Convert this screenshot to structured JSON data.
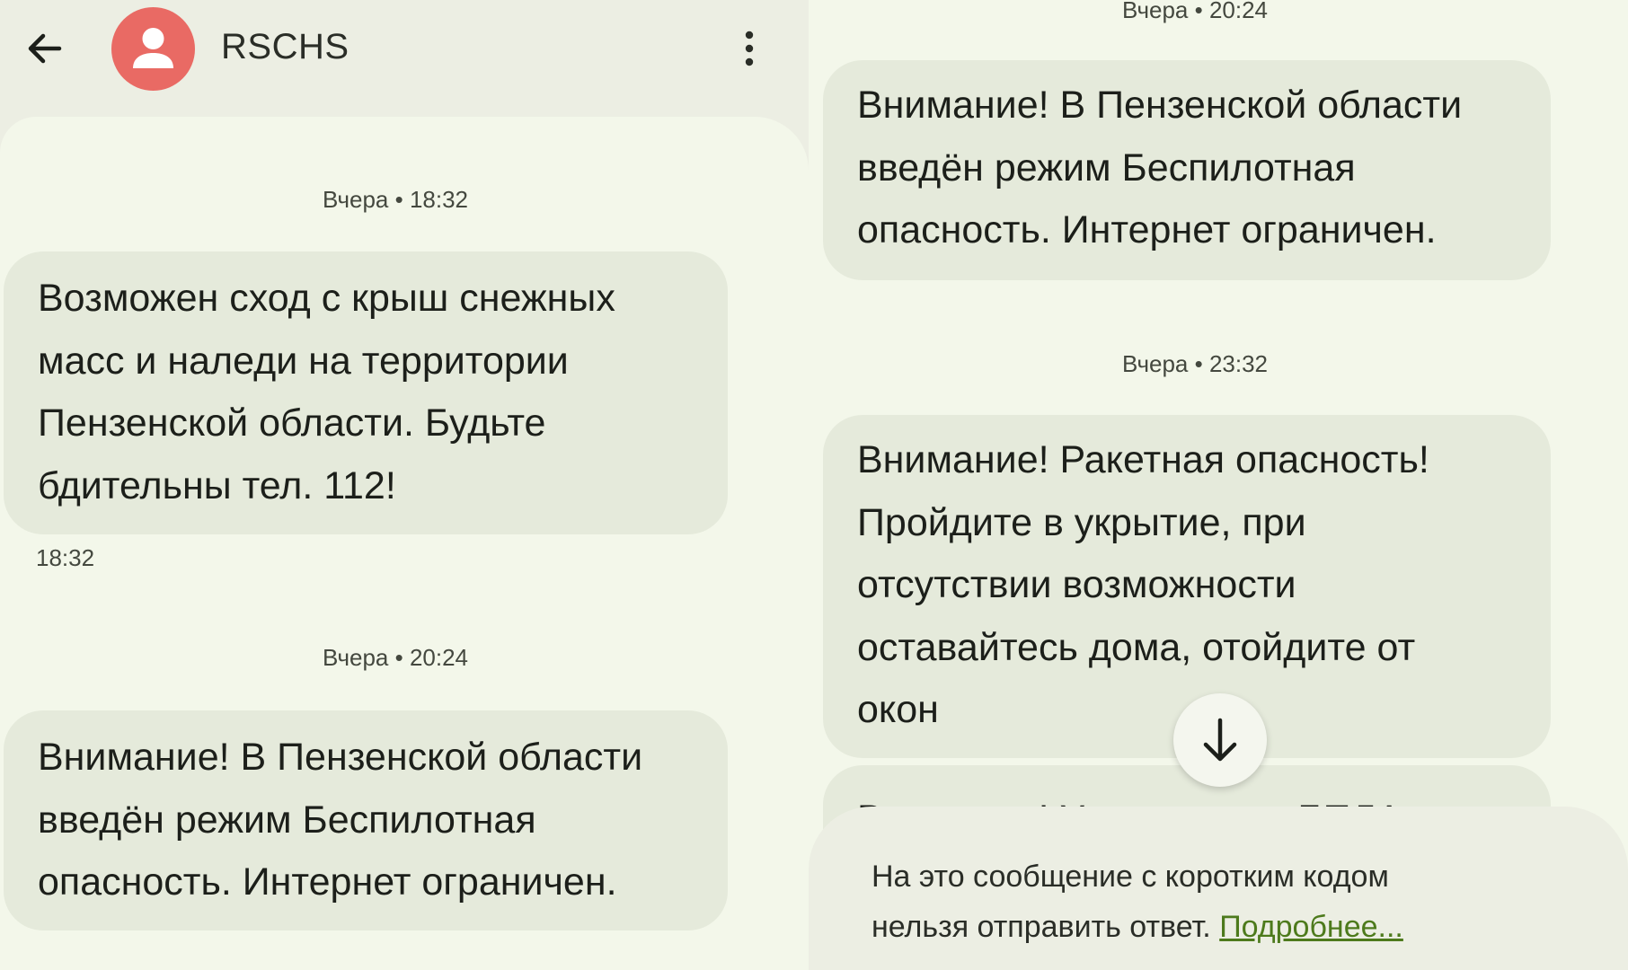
{
  "header": {
    "contact_name": "RSCHS",
    "colors": {
      "avatar": "#e96a64"
    }
  },
  "left_thread": [
    {
      "stamp": "Вчера • 18:32",
      "lines": [
        "Возможен сход с крыш снежных",
        "масс и наледи на территории",
        "Пензенской области. Будьте",
        "бдительны тел. 112!"
      ],
      "time": "18:32"
    },
    {
      "stamp": "Вчера • 20:24",
      "lines": [
        "Внимание! В Пензенской области",
        "введён режим Беспилотная",
        "опасность. Интернет ограничен."
      ]
    }
  ],
  "right_thread": [
    {
      "stamp": "Вчера • 20:24",
      "lines": [
        "Внимание! В Пензенской области",
        "введён режим Беспилотная",
        "опасность. Интернет ограничен."
      ]
    },
    {
      "stamp": "Вчера • 23:32",
      "lines": [
        "Внимание! Ракетная опасность!",
        "Пройдите в укрытие, при",
        "отсутствии возможности",
        "оставайтесь дома, отойдите от",
        "окон"
      ]
    }
  ],
  "peek_message": "Внимание! Угроза атаки БПЛА на",
  "reply_notice": {
    "line1": "На это сообщение с коротким кодом",
    "line2": "нельзя отправить ответ. ",
    "link": "Подробнее..."
  }
}
